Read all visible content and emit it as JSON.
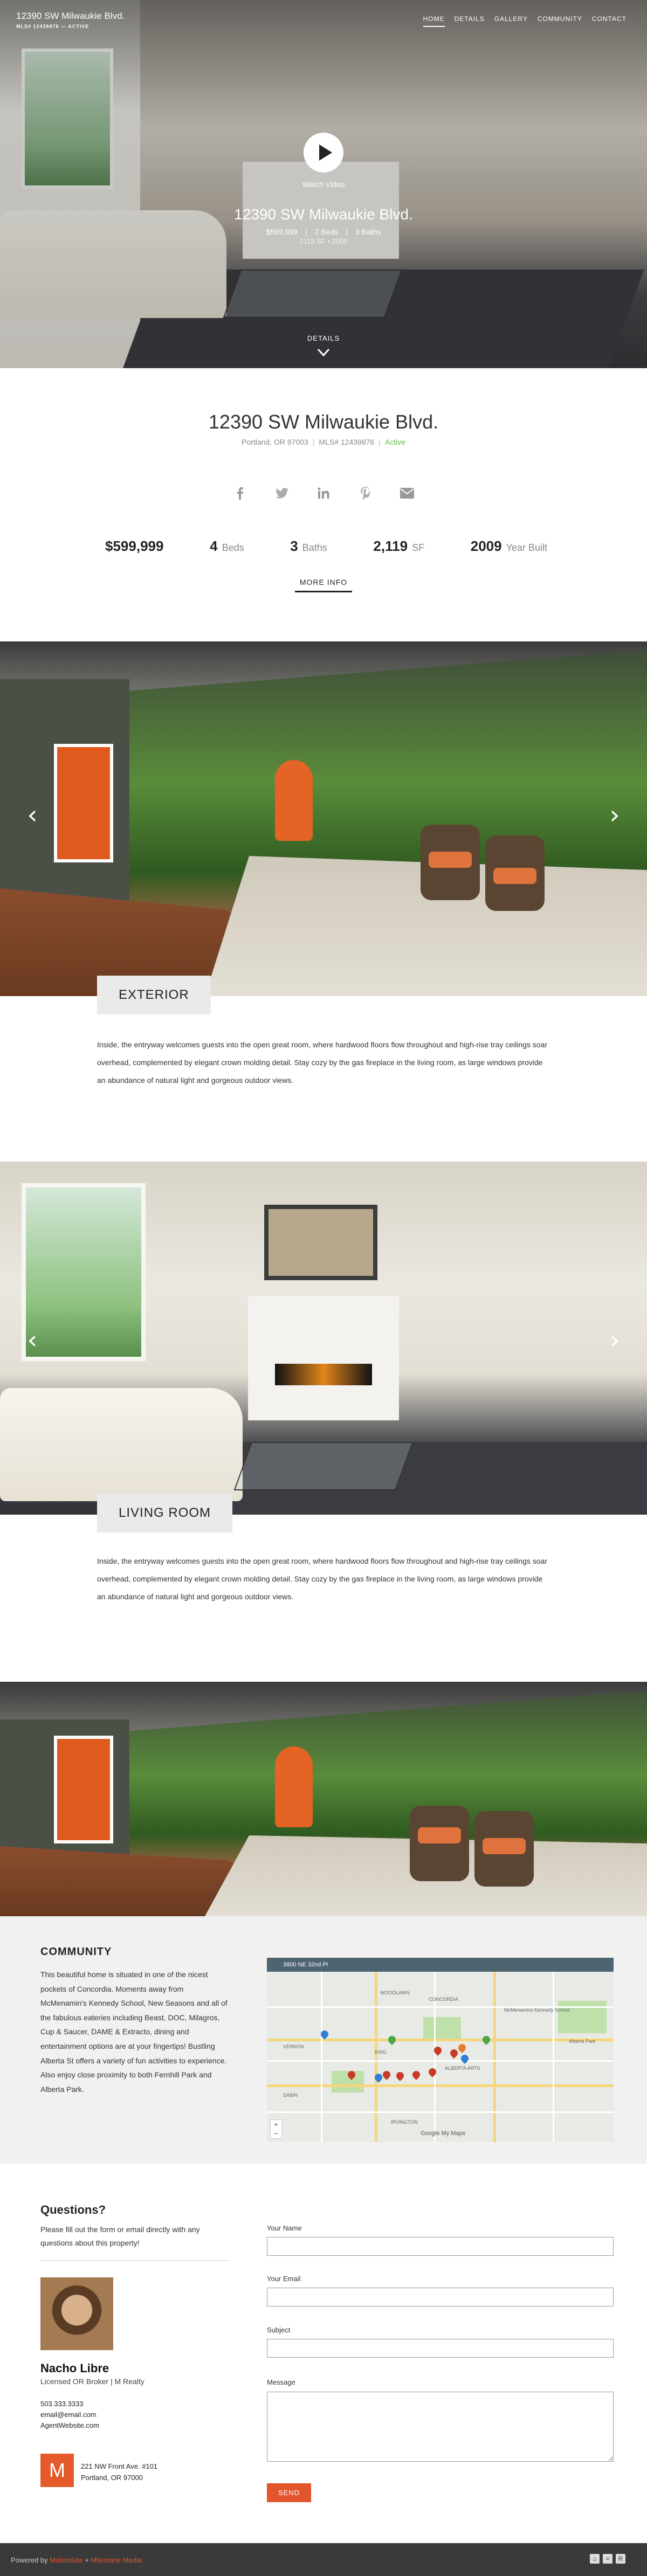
{
  "header": {
    "title": "12390 SW Milwaukie Blvd.",
    "meta": "MLS# 12439876  —  ACTIVE",
    "nav": [
      "HOME",
      "DETAILS",
      "GALLERY",
      "COMMUNITY",
      "CONTACT"
    ]
  },
  "hero": {
    "watch_label": "Watch Video",
    "address": "12390 SW Milwaukie Blvd.",
    "price": "$599,999",
    "beds": "2 Beds",
    "baths": "3 Baths",
    "subline": "2119 SF   •   2009",
    "details_label": "DETAILS"
  },
  "summary": {
    "address": "12390 SW Milwaukie Blvd.",
    "city": "Portland, OR 97003",
    "mls": "MLS# 12439876",
    "status": "Active",
    "social_icons": [
      "facebook-icon",
      "twitter-icon",
      "linkedin-icon",
      "pinterest-icon",
      "email-icon"
    ],
    "price": "$599,999",
    "beds_num": "4",
    "beds_unit": "Beds",
    "baths_num": "3",
    "baths_unit": "Baths",
    "sqft_num": "2,119",
    "sqft_unit": "SF",
    "year_num": "2009",
    "year_unit": "Year Built",
    "more_info": "MORE INFO"
  },
  "exterior": {
    "label": "EXTERIOR",
    "description": "Inside, the entryway welcomes guests into the open great room, where hardwood floors flow throughout and high-rise tray ceilings soar overhead, complemented by elegant crown molding detail. Stay cozy by the gas fireplace in the living room, as large windows provide an abundance of natural light and gorgeous outdoor views."
  },
  "living": {
    "label": "LIVING ROOM",
    "description": "Inside, the entryway welcomes guests into the open great room, where hardwood floors flow throughout and high-rise tray ceilings soar overhead, complemented by elegant crown molding detail. Stay cozy by the gas fireplace in the living room, as large windows provide an abundance of natural light and gorgeous outdoor views."
  },
  "community": {
    "title": "COMMUNITY",
    "text": "This beautiful home is situated in one of the nicest pockets of Concordia. Moments away from McMenamin's Kennedy School, New Seasons and all of the fabulous eateries including Beast, DOC, Milagros, Cup & Saucer, DAME & Extracto, dining and entertainment options are at your fingertips! Bustling Alberta St offers a variety of fun activities to experience. Also enjoy close proximity to both Fernhill Park and Alberta Park.",
    "map_title": "3800 NE 32nd Pl",
    "map_labels": [
      "WOODLAWN",
      "CONCORDIA",
      "VERNON",
      "SABIN",
      "ALBERTA ARTS",
      "KING",
      "IRVINGTON",
      "McMenamins Kennedy School",
      "Alberta Park"
    ],
    "map_credit": "Google My Maps"
  },
  "contact": {
    "title": "Questions?",
    "text": "Please fill out the form or email directly with any questions about this property!",
    "agent_name": "Nacho Libre",
    "agent_role": "Licensed OR Broker | M Realty",
    "phone": "503.333.3333",
    "email": "email@email.com",
    "website": "AgentWebsite.com",
    "logo_letter": "M",
    "office_line1": "221 NW Front Ave. #101",
    "office_line2": "Portland, OR 97000",
    "form": {
      "name_label": "Your Name",
      "email_label": "Your Email",
      "subject_label": "Subject",
      "message_label": "Message",
      "send_label": "SEND"
    }
  },
  "footer": {
    "powered_by": "Powered by",
    "brand1": "MotionSite",
    "separator": " + ",
    "brand2": "Milestone Media"
  },
  "colors": {
    "accent": "#e2552d",
    "active_status": "#6cb74b",
    "footer_bg": "#3a3a3a"
  }
}
